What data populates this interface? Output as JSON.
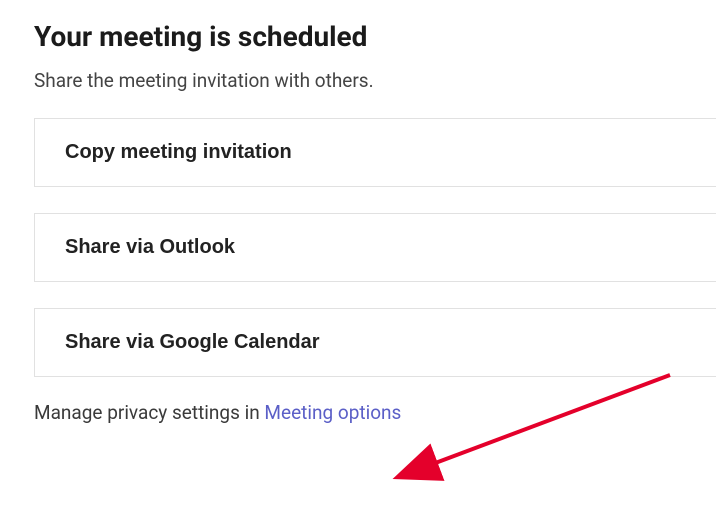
{
  "heading": "Your meeting is scheduled",
  "subheading": "Share the meeting invitation with others.",
  "buttons": {
    "copy": "Copy meeting invitation",
    "outlook": "Share via Outlook",
    "google": "Share via Google Calendar"
  },
  "privacy": {
    "prefix": "Manage privacy settings in ",
    "link": "Meeting options"
  }
}
